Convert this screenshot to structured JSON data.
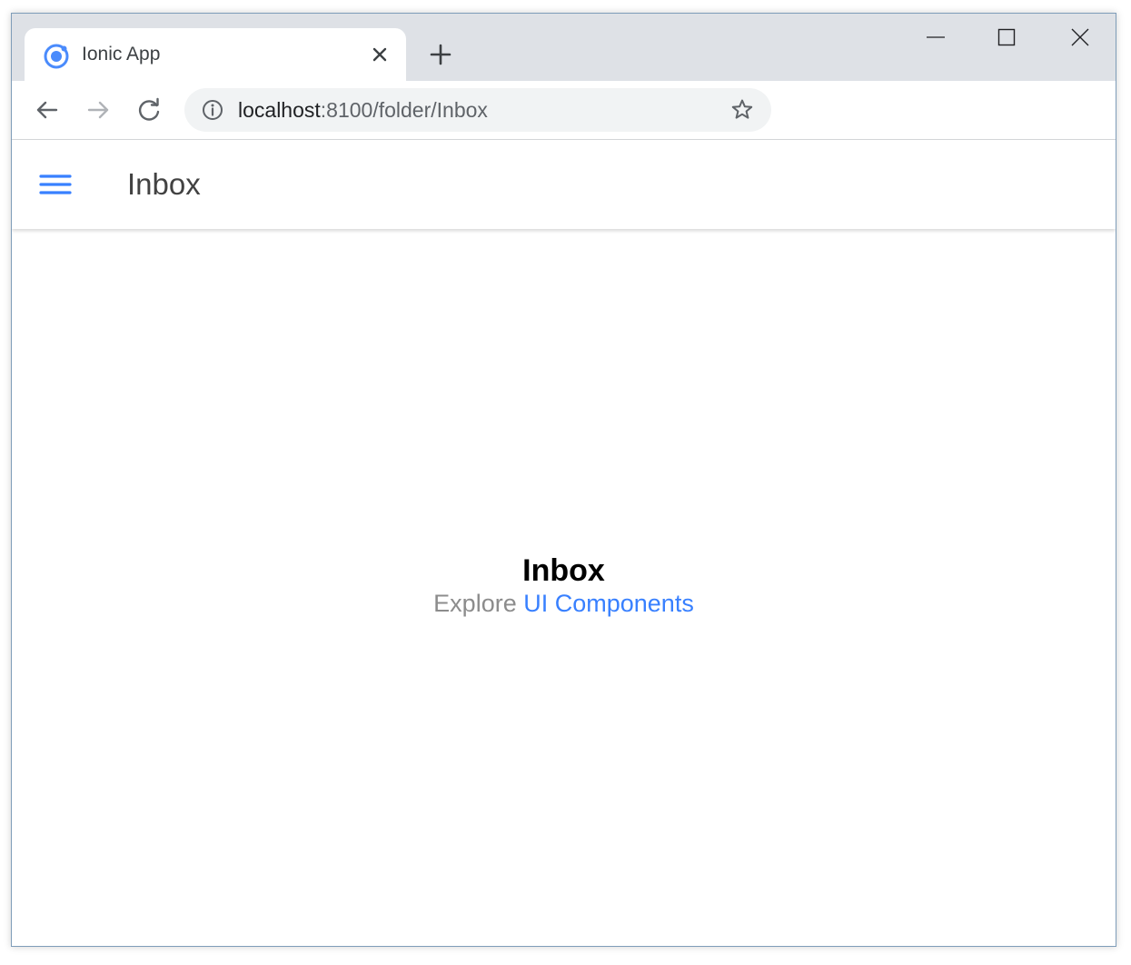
{
  "browser": {
    "tab": {
      "title": "Ionic App",
      "favicon": "ionic-logo-icon"
    },
    "new_tab_icon": "plus-icon",
    "window_controls": [
      "minimize-icon",
      "maximize-icon",
      "close-icon"
    ],
    "address": {
      "host": "localhost",
      "path": ":8100/folder/Inbox"
    }
  },
  "app": {
    "header_title": "Inbox",
    "menu_icon": "menu-icon",
    "content": {
      "title": "Inbox",
      "explore_prefix": "Explore",
      "link_text": "UI Components"
    }
  },
  "colors": {
    "accent": "#3880ff",
    "tabstrip": "#dee1e6",
    "omnibox": "#f1f3f4"
  }
}
